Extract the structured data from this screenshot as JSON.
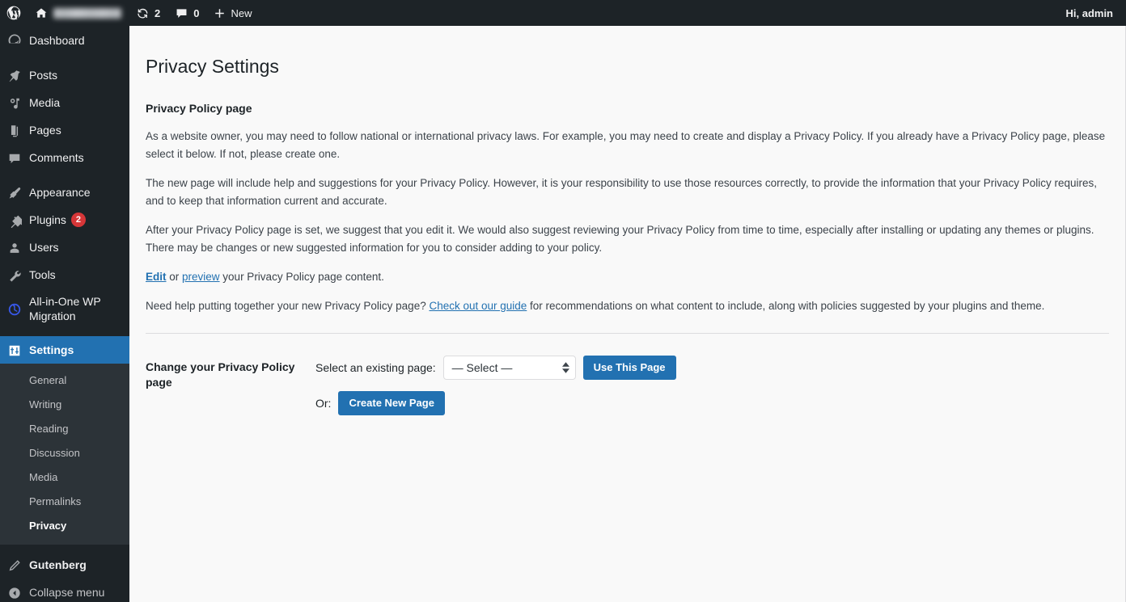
{
  "adminbar": {
    "wp_logo": "wordpress-logo",
    "site_home_icon": "home-icon",
    "site_name_redacted": "",
    "updates_icon": "updates-icon",
    "updates_count": "2",
    "comments_icon": "comment-bubble-icon",
    "comments_count": "0",
    "new_icon": "plus-icon",
    "new_label": "New",
    "howdy": "Hi, admin"
  },
  "sidebar": {
    "items": [
      {
        "label": "Dashboard",
        "icon": "dashboard-icon",
        "badge": ""
      },
      {
        "label": "Posts",
        "icon": "pin-icon",
        "badge": ""
      },
      {
        "label": "Media",
        "icon": "media-icon",
        "badge": ""
      },
      {
        "label": "Pages",
        "icon": "pages-icon",
        "badge": ""
      },
      {
        "label": "Comments",
        "icon": "comment-bubble-icon",
        "badge": ""
      },
      {
        "label": "Appearance",
        "icon": "paintbrush-icon",
        "badge": ""
      },
      {
        "label": "Plugins",
        "icon": "plug-icon",
        "badge": "2"
      },
      {
        "label": "Users",
        "icon": "user-icon",
        "badge": ""
      },
      {
        "label": "Tools",
        "icon": "wrench-icon",
        "badge": ""
      },
      {
        "label": "All-in-One WP Migration",
        "icon": "migration-circle-arrow-icon",
        "badge": ""
      },
      {
        "label": "Settings",
        "icon": "settings-sliders-icon",
        "badge": ""
      }
    ],
    "settings_submenu": [
      {
        "label": "General"
      },
      {
        "label": "Writing"
      },
      {
        "label": "Reading"
      },
      {
        "label": "Discussion"
      },
      {
        "label": "Media"
      },
      {
        "label": "Permalinks"
      },
      {
        "label": "Privacy"
      }
    ],
    "gutenberg": {
      "label": "Gutenberg",
      "icon": "pencil-icon"
    },
    "collapse": {
      "label": "Collapse menu",
      "icon": "collapse-arrow-icon"
    },
    "active_item": "Settings",
    "current_submenu": "Privacy"
  },
  "page": {
    "title": "Privacy Settings",
    "section_heading": "Privacy Policy page",
    "paragraph_1": "As a website owner, you may need to follow national or international privacy laws. For example, you may need to create and display a Privacy Policy. If you already have a Privacy Policy page, please select it below. If not, please create one.",
    "paragraph_2": "The new page will include help and suggestions for your Privacy Policy. However, it is your responsibility to use those resources correctly, to provide the information that your Privacy Policy requires, and to keep that information current and accurate.",
    "paragraph_3": "After your Privacy Policy page is set, we suggest that you edit it. We would also suggest reviewing your Privacy Policy from time to time, especially after installing or updating any themes or plugins. There may be changes or new suggested information for you to consider adding to your policy.",
    "edit_line": {
      "edit_link": "Edit",
      "or_text": " or ",
      "preview_link": "preview",
      "tail_text": " your Privacy Policy page content."
    },
    "guide_line": {
      "lead_text": "Need help putting together your new Privacy Policy page? ",
      "guide_link": "Check out our guide",
      "tail_text": " for recommendations on what content to include, along with policies suggested by your plugins and theme."
    }
  },
  "form": {
    "row_label": "Change your Privacy Policy page",
    "select_label": "Select an existing page:",
    "select_value": "— Select —",
    "use_page_button": "Use This Page",
    "or_label": "Or:",
    "create_page_button": "Create New Page"
  },
  "colors": {
    "admin_dark": "#1d2327",
    "submenu_dark": "#2c3338",
    "accent_blue": "#2271b1",
    "link_blue": "#2271b1",
    "badge_red": "#d63638",
    "content_bg": "#f9f9f9"
  }
}
